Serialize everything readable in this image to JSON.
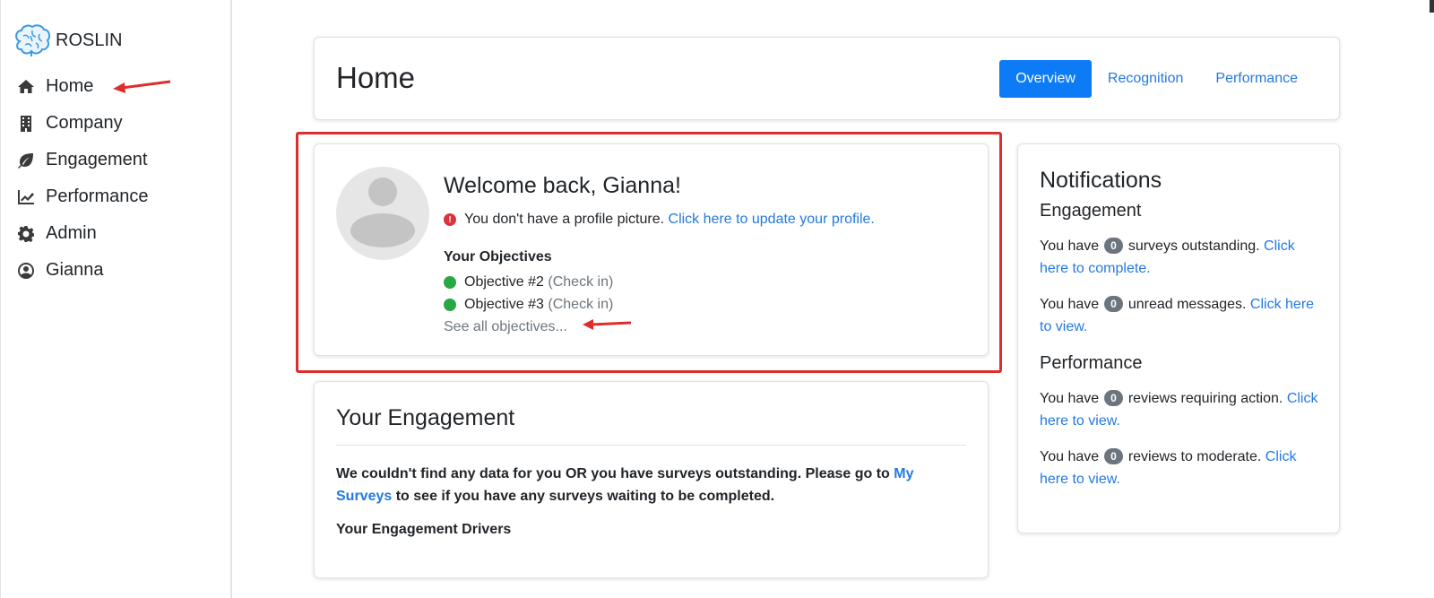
{
  "sidebar": {
    "brand": "ROSLIN",
    "items": [
      {
        "label": "Home",
        "icon": "home-icon"
      },
      {
        "label": "Company",
        "icon": "building-icon"
      },
      {
        "label": "Engagement",
        "icon": "leaf-icon"
      },
      {
        "label": "Performance",
        "icon": "chart-line-icon"
      },
      {
        "label": "Admin",
        "icon": "gear-icon"
      },
      {
        "label": "Gianna",
        "icon": "user-circle-icon"
      }
    ]
  },
  "header": {
    "title": "Home",
    "tabs": [
      {
        "label": "Overview",
        "active": true
      },
      {
        "label": "Recognition",
        "active": false
      },
      {
        "label": "Performance",
        "active": false
      }
    ]
  },
  "welcome": {
    "title": "Welcome back, Gianna!",
    "alert_text": "You don't have a profile picture.",
    "alert_link": "Click here to update your profile.",
    "objectives_heading": "Your Objectives",
    "objectives": [
      {
        "name": "Objective #2",
        "action": "(Check in)"
      },
      {
        "name": "Objective #3",
        "action": "(Check in)"
      }
    ],
    "see_all": "See all objectives..."
  },
  "engagement": {
    "title": "Your Engagement",
    "message_pre": "We couldn't find any data for you OR you have surveys outstanding. Please go to",
    "message_link": "My Surveys",
    "message_post": "to see if you have any surveys waiting to be completed.",
    "drivers_heading": "Your Engagement Drivers"
  },
  "notifications": {
    "title": "Notifications",
    "engagement_heading": "Engagement",
    "performance_heading": "Performance",
    "items": [
      {
        "pre": "You have",
        "count": "0",
        "text": "surveys outstanding.",
        "link": "Click here to complete."
      },
      {
        "pre": "You have",
        "count": "0",
        "text": "unread messages.",
        "link": "Click here to view."
      },
      {
        "pre": "You have",
        "count": "0",
        "text": "reviews requiring action.",
        "link": "Click here to view."
      },
      {
        "pre": "You have",
        "count": "0",
        "text": "reviews to moderate.",
        "link": "Click here to view."
      }
    ]
  },
  "colors": {
    "accent": "#0d7bf6",
    "link": "#2479e0",
    "annotation": "#dd2e2e",
    "status_ok": "#28a745",
    "alert": "#d9343b"
  }
}
